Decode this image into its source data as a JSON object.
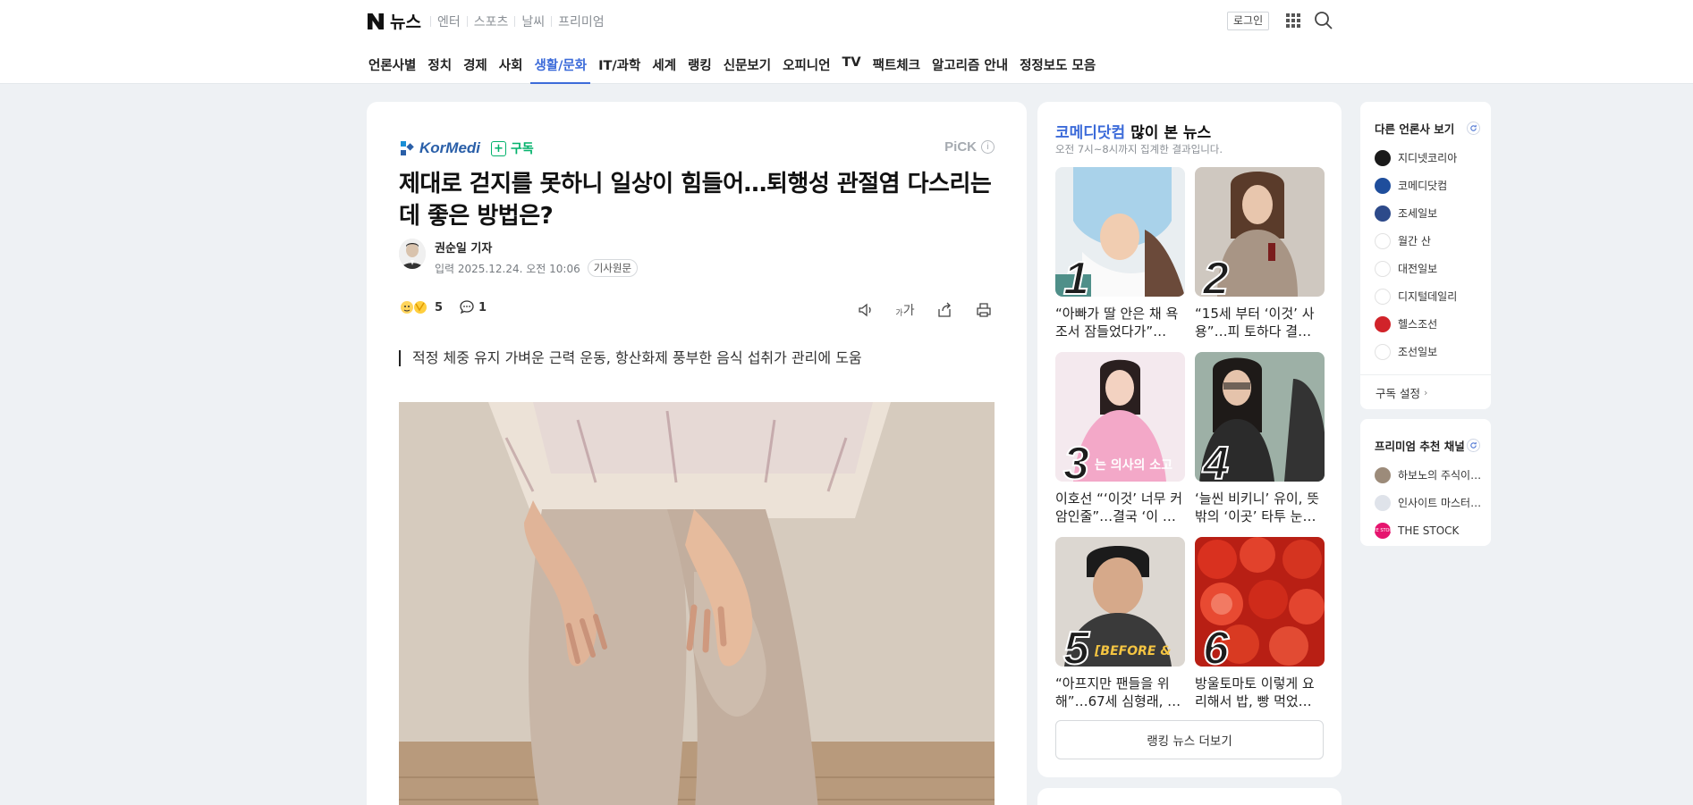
{
  "header": {
    "brand": "뉴스",
    "service_links": [
      "엔터",
      "스포츠",
      "날씨",
      "프리미엄"
    ],
    "login_label": "로그인"
  },
  "gnb": {
    "items": [
      "언론사별",
      "정치",
      "경제",
      "사회",
      "생활/문화",
      "IT/과학",
      "세계",
      "랭킹",
      "신문보기",
      "오피니언",
      "TV",
      "팩트체크",
      "알고리즘 안내",
      "정정보도 모음"
    ],
    "active": "생활/문화"
  },
  "article": {
    "press_name": "KorMedi",
    "subscribe_label": "구독",
    "pick_label": "PiCK",
    "headline": "제대로 걷지를 못하니 일상이 힘들어…퇴행성 관절염 다스리는 데 좋은 방법은?",
    "reporter": "권순일 기자",
    "date": "입력 2025.12.24. 오전 10:06",
    "origin_label": "기사원문",
    "reaction_count": "5",
    "comment_count": "1",
    "font_size_tool": "가",
    "summary": "적정 체중 유지 가벼운 근력 운동, 항산화제 풍부한 음식 섭취가 관리에 도움"
  },
  "ranking": {
    "press": "코메디닷컴",
    "title_suffix": " 많이 본 뉴스",
    "subtitle": "오전 7시~8시까지 집계한 결과입니다.",
    "items": [
      {
        "rank": "1",
        "title": "“아빠가 딸 안은 채 욕조서 잠들었다가”…"
      },
      {
        "rank": "2",
        "title": "“15세 부터 ‘이것’ 사용”…피 토하다 결…"
      },
      {
        "rank": "3",
        "title": "이호선 “‘이것’ 너무 커 암인줄”…결국 ‘이 …"
      },
      {
        "rank": "4",
        "title": "‘늘씬 비키니’ 유이, 뜻밖의 ‘이곳’ 타투 눈…"
      },
      {
        "rank": "5",
        "title": "“아프지만 팬들을 위해”…67세 심형래, …"
      },
      {
        "rank": "6",
        "title": "방울토마토 이렇게 요리해서 밥, 빵 먹었…"
      }
    ],
    "thumb_overlays": {
      "3": "는 의사의 소고",
      "5": "[BEFORE &"
    },
    "more_label": "랭킹 뉴스 더보기"
  },
  "sidebar": {
    "other_press_title": "다른 언론사 보기",
    "other_press": [
      "지디넷코리아",
      "코메디닷컴",
      "조세일보",
      "월간 산",
      "대전일보",
      "디지털데일리",
      "헬스조선",
      "조선일보"
    ],
    "subscribe_settings": "구독 설정",
    "premium_title": "프리미엄 추천 채널",
    "premium": [
      "하보노의 주식이…",
      "인사이트 마스터…",
      "THE STOCK"
    ],
    "premium_badge": "THE STOCK"
  },
  "colors": {
    "accent": "#3c6bd9",
    "subscribe_green": "#03b26c",
    "background": "#eef1f4"
  }
}
